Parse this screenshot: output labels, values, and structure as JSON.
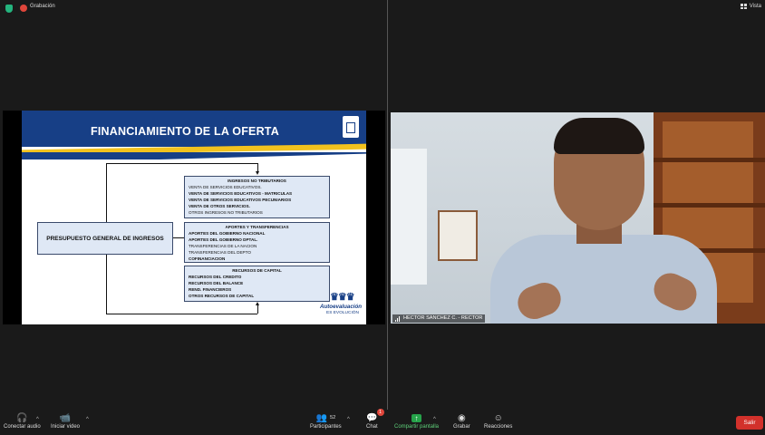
{
  "top_bar": {
    "recording_label": "Grabación",
    "view_label": "Vista"
  },
  "slide": {
    "title": "FINANCIAMIENTO DE LA OFERTA",
    "main_box": "PRESUPUESTO GENERAL DE INGRESOS",
    "boxes": [
      {
        "heading": "INGRESOS NO TRIBUTARIOS",
        "items": [
          "VENTA DE SERVICIOS EDUCATIVOS.",
          "VENTA DE SERVICIOS EDUCATIVOS - MATRICULAS",
          "VENTA DE SERVICIOS EDUCATIVOS PECUNIARIOS",
          "VENTA DE OTROS SERVICIOS.",
          "OTROS INGRESOS NO TRIBUTARIOS"
        ]
      },
      {
        "heading": "APORTES Y TRANSFERENCIAS",
        "items": [
          "APORTES DEL GOBIERNO NACIONAL",
          "APORTES DEL GOBIERNO DPTAL.",
          "TRANSFERENCIAS DE LA NACION",
          "TRANSFERENCIAS DEL DEPTO",
          "COFINANCIACION"
        ]
      },
      {
        "heading": "RECURSOS DE CAPITAL",
        "items": [
          "RECURSOS DEL CREDITO",
          "RECURSOS DEL BALANCE",
          "REND. FINANCIEROS",
          "OTROS RECURSOS DE CAPITAL"
        ]
      }
    ],
    "brand": "Autoevaluación",
    "brand_sub": "ES EVOLUCIÓN"
  },
  "video": {
    "participant_name": "HECTOR SANCHEZ C. - RECTOR"
  },
  "toolbar": {
    "audio_label": "Conectar audio",
    "video_label": "Iniciar video",
    "participants_label": "Participantes",
    "participants_count": "52",
    "chat_label": "Chat",
    "chat_badge": "1",
    "share_label": "Compartir pantalla",
    "record_label": "Grabar",
    "reactions_label": "Reacciones",
    "leave_label": "Salir"
  },
  "colors": {
    "slide_blue": "#173f86",
    "slide_yellow": "#f2c21e",
    "share_green": "#26a34a",
    "leave_red": "#d2312b"
  }
}
